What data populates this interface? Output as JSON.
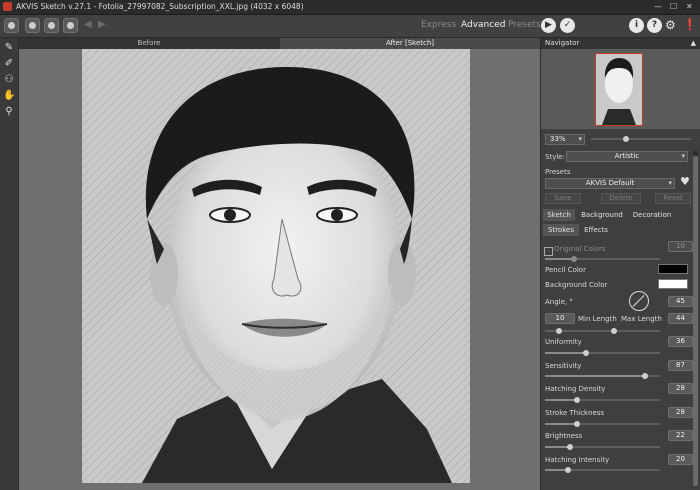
{
  "titlebar": {
    "title": "AKVIS Sketch v.27.1 - Fotolia_27997082_Subscription_XXL.jpg (4032 x 6048)"
  },
  "toolbar": {
    "modes": [
      "Express",
      "Advanced",
      "Presets"
    ],
    "active_mode": "Advanced"
  },
  "canvas": {
    "tabs": [
      "Before",
      "After [Sketch]"
    ],
    "active_tab": "After [Sketch]"
  },
  "navigator": {
    "title": "Navigator",
    "zoom": "33%"
  },
  "style": {
    "label": "Style:",
    "value": "Artistic"
  },
  "presets": {
    "label": "Presets",
    "value": "AKVIS Default",
    "save": "Save",
    "delete": "Delete",
    "reset": "Reset"
  },
  "tabs": {
    "main": [
      "Sketch",
      "Background",
      "Decoration"
    ],
    "sub": [
      "Strokes",
      "Effects"
    ]
  },
  "params": {
    "original_colors": {
      "label": "Original Colors",
      "value": "10",
      "checked": false,
      "level": 0.25
    },
    "pencil_color": {
      "label": "Pencil Color",
      "color": "#000000"
    },
    "background_color": {
      "label": "Background Color",
      "color": "#ffffff"
    },
    "angle": {
      "label": "Angle, °",
      "value": "45"
    },
    "min_length": {
      "label": "Min Length",
      "value": "10"
    },
    "max_length": {
      "label": "Max Length",
      "value": "44"
    },
    "uniformity": {
      "label": "Uniformity",
      "value": "36",
      "level": 0.36
    },
    "sensitivity": {
      "label": "Sensitivity",
      "value": "87",
      "level": 0.87
    },
    "hatching_density": {
      "label": "Hatching Density",
      "value": "28",
      "level": 0.28
    },
    "stroke_thickness": {
      "label": "Stroke Thickness",
      "value": "28",
      "level": 0.28
    },
    "brightness": {
      "label": "Brightness",
      "value": "22",
      "level": 0.22
    },
    "hatching_intensity": {
      "label": "Hatching Intensity",
      "value": "20",
      "level": 0.2
    }
  }
}
